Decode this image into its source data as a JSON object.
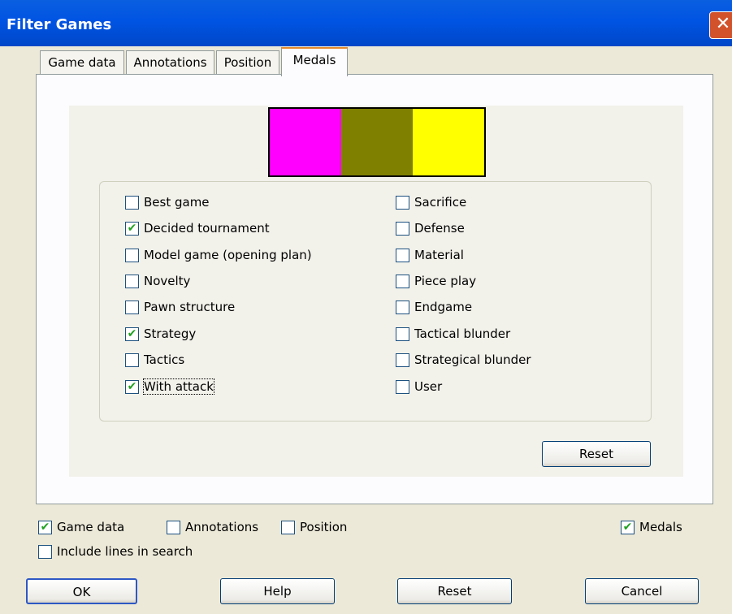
{
  "window": {
    "title": "Filter Games",
    "close_glyph": "✕"
  },
  "tabs": [
    {
      "label": "Game data",
      "active": false
    },
    {
      "label": "Annotations",
      "active": false
    },
    {
      "label": "Position",
      "active": false
    },
    {
      "label": "Medals",
      "active": true
    }
  ],
  "medal_colors": [
    "#ff00ff",
    "#808000",
    "#ffff00"
  ],
  "medals_left": [
    {
      "label": "Best game",
      "checked": false
    },
    {
      "label": "Decided tournament",
      "checked": true
    },
    {
      "label": "Model game (opening plan)",
      "checked": false
    },
    {
      "label": "Novelty",
      "checked": false
    },
    {
      "label": "Pawn structure",
      "checked": false
    },
    {
      "label": "Strategy",
      "checked": true
    },
    {
      "label": "Tactics",
      "checked": false
    },
    {
      "label": "With attack",
      "checked": true
    }
  ],
  "medals_right": [
    {
      "label": "Sacrifice",
      "checked": false
    },
    {
      "label": "Defense",
      "checked": false
    },
    {
      "label": "Material",
      "checked": false
    },
    {
      "label": "Piece play",
      "checked": false
    },
    {
      "label": "Endgame",
      "checked": false
    },
    {
      "label": "Tactical blunder",
      "checked": false
    },
    {
      "label": "Strategical blunder",
      "checked": false
    },
    {
      "label": "User",
      "checked": false
    }
  ],
  "panel_reset_label": "Reset",
  "filters": {
    "game_data": {
      "label": "Game data",
      "checked": true
    },
    "annotations": {
      "label": "Annotations",
      "checked": false
    },
    "position": {
      "label": "Position",
      "checked": false
    },
    "medals": {
      "label": "Medals",
      "checked": true
    },
    "include_lines": {
      "label": "Include lines in search",
      "checked": false
    }
  },
  "buttons": {
    "ok": "OK",
    "help": "Help",
    "reset": "Reset",
    "cancel": "Cancel"
  },
  "check_glyph": "✔"
}
